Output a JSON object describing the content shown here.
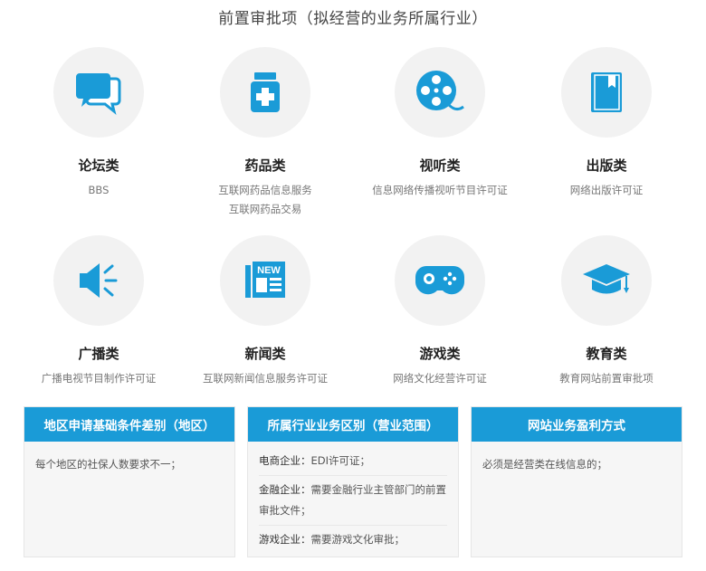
{
  "page": {
    "title": "前置审批项（拟经营的业务所属行业）"
  },
  "categories": [
    {
      "name": "论坛类",
      "icon": "chat-bubbles-icon",
      "desc": [
        "BBS"
      ]
    },
    {
      "name": "药品类",
      "icon": "medicine-bottle-icon",
      "desc": [
        "互联网药品信息服务",
        "互联网药品交易"
      ]
    },
    {
      "name": "视听类",
      "icon": "film-reel-icon",
      "desc": [
        "信息网络传播视听节目许可证"
      ]
    },
    {
      "name": "出版类",
      "icon": "book-icon",
      "desc": [
        "网络出版许可证"
      ]
    },
    {
      "name": "广播类",
      "icon": "speaker-icon",
      "desc": [
        "广播电视节目制作许可证"
      ]
    },
    {
      "name": "新闻类",
      "icon": "newspaper-icon",
      "badge": "NEW",
      "desc": [
        "互联网新闻信息服务许可证"
      ]
    },
    {
      "name": "游戏类",
      "icon": "gamepad-icon",
      "desc": [
        "网络文化经营许可证"
      ]
    },
    {
      "name": "教育类",
      "icon": "graduation-cap-icon",
      "desc": [
        "教育网站前置审批项"
      ]
    }
  ],
  "boxes": [
    {
      "title": "地区申请基础条件差别（地区）",
      "text": "每个地区的社保人数要求不一；"
    },
    {
      "title": "所属行业业务区别（营业范围）",
      "lines": [
        {
          "key": "电商企业：",
          "value": "EDI许可证；"
        },
        {
          "key": "金融企业：",
          "value": "需要金融行业主管部门的前置审批文件；"
        },
        {
          "key": "游戏企业：",
          "value": "需要游戏文化审批；"
        }
      ]
    },
    {
      "title": "网站业务盈利方式",
      "text": "必须是经营类在线信息的；"
    }
  ],
  "colors": {
    "accent": "#1a9bd7",
    "circle_bg": "#f2f2f2"
  }
}
